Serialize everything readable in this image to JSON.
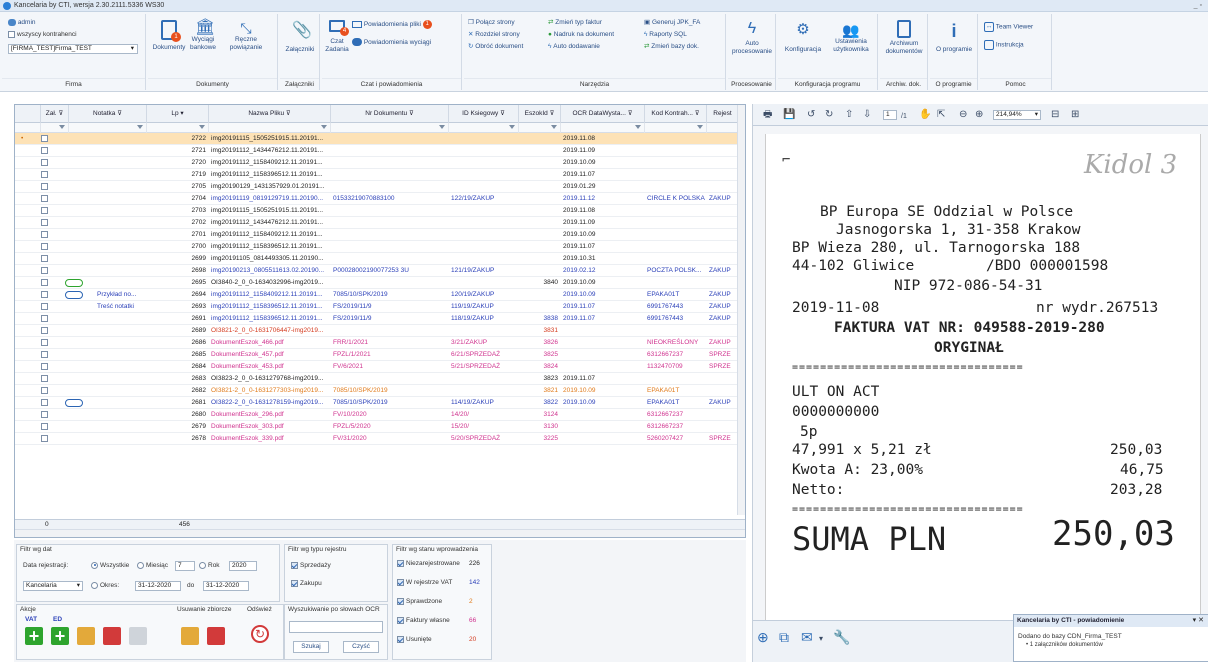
{
  "window": {
    "title": "Kancelaria by CTI, wersja 2.30.2111.5336 WS30",
    "controls": "_ ▫"
  },
  "ribbon": {
    "firma": {
      "user": "admin",
      "all_contractors": "wszyscy kontrahenci",
      "company": "[FIRMA_TEST]Firma_TEST",
      "label": "Firma"
    },
    "dokumenty": {
      "items": [
        "Dokumenty",
        "Wyciągi bankowe",
        "Ręczne powiązanie"
      ],
      "label": "Dokumenty",
      "badge": "1"
    },
    "zalaczniki": {
      "item": "Załączniki",
      "label": "Załączniki"
    },
    "czat": {
      "czat_zadania": "Czat Zadania",
      "badge": "4",
      "powiadomienia_pliki": "Powiadomienia pliki",
      "badge2": "1",
      "powiadomienia_wyciagi": "Powiadomienia wyciągi",
      "label": "Czat i powiadomienia"
    },
    "narzedzia": {
      "items": [
        "Połącz strony",
        "Zmień typ faktur",
        "Generuj JPK_FA",
        "Rozdziel strony",
        "Nadruk na dokument",
        "Raporty SQL",
        "Obróć dokument",
        "Auto dodawanie",
        "Zmień bazy dok."
      ],
      "label": "Narzędzia"
    },
    "procesowanie": {
      "item": "Auto procesowanie",
      "label": "Procesowanie"
    },
    "konfiguracja": {
      "items": [
        "Konfiguracja",
        "Ustawienia użytkownika"
      ],
      "label": "Konfiguracja programu"
    },
    "archiwum": {
      "item": "Archiwum dokumentów",
      "label": "Archiw. dok."
    },
    "oprogramie": {
      "item": "O programie",
      "label": "O programie"
    },
    "pomoc": {
      "items": [
        "Team Viewer",
        "Instrukcja"
      ],
      "label": "Pomoc"
    }
  },
  "grid": {
    "columns": [
      "Zał.",
      "Notatka",
      "Lp",
      "Nazwa Pliku",
      "Nr Dokumentu",
      "ID Ksiegowy",
      "EszokId",
      "OCR DataWysta...",
      "Kod Kontrah...",
      "Rejest"
    ],
    "rows": [
      {
        "lp": "2722",
        "file": "img20191115_1505251915.11.20191...",
        "nr": "",
        "id": "",
        "esz": "",
        "date": "2019.11.08",
        "kod": "",
        "rej": "",
        "color": "dark",
        "sel": true
      },
      {
        "lp": "2721",
        "file": "img20191112_1434476212.11.20191...",
        "nr": "",
        "id": "",
        "esz": "",
        "date": "2019.11.09",
        "kod": "",
        "rej": "",
        "color": "dark"
      },
      {
        "lp": "2720",
        "file": "img20191112_1158409212.11.20191...",
        "nr": "",
        "id": "",
        "esz": "",
        "date": "2019.10.09",
        "kod": "",
        "rej": "",
        "color": "dark"
      },
      {
        "lp": "2719",
        "file": "img20191112_1158396512.11.20191...",
        "nr": "",
        "id": "",
        "esz": "",
        "date": "2019.11.07",
        "kod": "",
        "rej": "",
        "color": "dark"
      },
      {
        "lp": "2705",
        "file": "img20190129_1431357929.01.20191...",
        "nr": "",
        "id": "",
        "esz": "",
        "date": "2019.01.29",
        "kod": "",
        "rej": "",
        "color": "dark"
      },
      {
        "lp": "2704",
        "file": "img20191119_0819129719.11.20190...",
        "nr": "01533219070883100",
        "id": "122/19/ZAKUP",
        "esz": "",
        "date": "2019.11.12",
        "kod": "CIRCLE K POLSKA",
        "rej": "ZAKUP",
        "color": "blue"
      },
      {
        "lp": "2703",
        "file": "img20191115_1505251915.11.20191...",
        "nr": "",
        "id": "",
        "esz": "",
        "date": "2019.11.08",
        "kod": "",
        "rej": "",
        "color": "dark"
      },
      {
        "lp": "2702",
        "file": "img20191112_1434476212.11.20191...",
        "nr": "",
        "id": "",
        "esz": "",
        "date": "2019.11.09",
        "kod": "",
        "rej": "",
        "color": "dark"
      },
      {
        "lp": "2701",
        "file": "img20191112_1158409212.11.20191...",
        "nr": "",
        "id": "",
        "esz": "",
        "date": "2019.10.09",
        "kod": "",
        "rej": "",
        "color": "dark"
      },
      {
        "lp": "2700",
        "file": "img20191112_1158396512.11.20191...",
        "nr": "",
        "id": "",
        "esz": "",
        "date": "2019.11.07",
        "kod": "",
        "rej": "",
        "color": "dark"
      },
      {
        "lp": "2699",
        "file": "img20191105_0814493305.11.20190...",
        "nr": "",
        "id": "",
        "esz": "",
        "date": "2019.10.31",
        "kod": "",
        "rej": "",
        "color": "dark"
      },
      {
        "lp": "2698",
        "file": "img20190213_0805511613.02.20190...",
        "nr": "P00028002190077253 3U",
        "id": "121/19/ZAKUP",
        "esz": "",
        "date": "2019.02.12",
        "kod": "POCZTA POLSK...",
        "rej": "ZAKUP",
        "color": "blue"
      },
      {
        "lp": "2695",
        "file": "OI3840-2_0_0-1634032996-img2019...",
        "nr": "",
        "id": "",
        "esz": "3840",
        "date": "2019.10.09",
        "kod": "",
        "rej": "",
        "color": "dark",
        "clip": "green"
      },
      {
        "lp": "2694",
        "file": "img20191112_1158409212.11.20191...",
        "nr": "7085/10/SPK/2019",
        "id": "120/19/ZAKUP",
        "esz": "",
        "date": "2019.10.09",
        "kod": "EPAKA01T",
        "rej": "ZAKUP",
        "color": "blue",
        "clip": "blue",
        "note": "Przykład no..."
      },
      {
        "lp": "2693",
        "file": "img20191112_1158396512.11.20191...",
        "nr": "FS/2019/11/9",
        "id": "119/19/ZAKUP",
        "esz": "",
        "date": "2019.11.07",
        "kod": "6991767443",
        "rej": "ZAKUP",
        "color": "blue",
        "note": "Treść notatki"
      },
      {
        "lp": "2691",
        "file": "img20191112_1158396512.11.20191...",
        "nr": "FS/2019/11/9",
        "id": "118/19/ZAKUP",
        "esz": "3838",
        "date": "2019.11.07",
        "kod": "6991767443",
        "rej": "ZAKUP",
        "color": "blue"
      },
      {
        "lp": "2689",
        "file": "OI3821-2_0_0-1631706447-img2019...",
        "nr": "",
        "id": "",
        "esz": "3831",
        "date": "",
        "kod": "",
        "rej": "",
        "color": "red"
      },
      {
        "lp": "2686",
        "file": "DokumentEszok_466.pdf",
        "nr": "FRR/1/2021",
        "id": "3/21/ZAKUP",
        "esz": "3826",
        "date": "",
        "kod": "NIEOKREŚLONY",
        "rej": "ZAKUP",
        "color": "pink"
      },
      {
        "lp": "2685",
        "file": "DokumentEszok_457.pdf",
        "nr": "FPZL/1/2021",
        "id": "6/21/SPRZEDAŻ",
        "esz": "3825",
        "date": "",
        "kod": "6312667237",
        "rej": "SPRZE",
        "color": "pink"
      },
      {
        "lp": "2684",
        "file": "DokumentEszok_453.pdf",
        "nr": "FV/6/2021",
        "id": "5/21/SPRZEDAŻ",
        "esz": "3824",
        "date": "",
        "kod": "1132470709",
        "rej": "SPRZE",
        "color": "pink"
      },
      {
        "lp": "2683",
        "file": "OI3823-2_0_0-1631279768-img2019...",
        "nr": "",
        "id": "",
        "esz": "3823",
        "date": "2019.11.07",
        "kod": "",
        "rej": "",
        "color": "dark"
      },
      {
        "lp": "2682",
        "file": "OI3821-2_0_0-1631277303-img2019...",
        "nr": "7085/10/SPK/2019",
        "id": "",
        "esz": "3821",
        "date": "2019.10.09",
        "kod": "EPAKA01T",
        "rej": "",
        "color": "orange"
      },
      {
        "lp": "2681",
        "file": "OI3822-2_0_0-1631278159-img2019...",
        "nr": "7085/10/SPK/2019",
        "id": "114/19/ZAKUP",
        "esz": "3822",
        "date": "2019.10.09",
        "kod": "EPAKA01T",
        "rej": "ZAKUP",
        "color": "blue",
        "clip": "blue"
      },
      {
        "lp": "2680",
        "file": "DokumentEszok_296.pdf",
        "nr": "FV/10/2020",
        "id": "14/20/",
        "esz": "3124",
        "date": "",
        "kod": "6312667237",
        "rej": "",
        "color": "pink"
      },
      {
        "lp": "2679",
        "file": "DokumentEszok_303.pdf",
        "nr": "FPZL/5/2020",
        "id": "15/20/",
        "esz": "3130",
        "date": "",
        "kod": "6312667237",
        "rej": "",
        "color": "pink"
      },
      {
        "lp": "2678",
        "file": "DokumentEszok_339.pdf",
        "nr": "FV/31/2020",
        "id": "5/20/SPRZEDAŻ",
        "esz": "3225",
        "date": "",
        "kod": "5260207427",
        "rej": "SPRZE",
        "color": "pink"
      }
    ],
    "footer_left": "0",
    "footer_count": "456"
  },
  "filters": {
    "date_title": "Filtr wg dat",
    "date_reg": "Data rejestracji:",
    "wszystkie": "Wszystkie",
    "miesiac": "Miesiąc",
    "month_val": "7",
    "rok": "Rok",
    "year_val": "2020",
    "kancelaria": "Kancelaria",
    "okres": "Okres:",
    "from": "31-12-2020",
    "do": "do",
    "to": "31-12-2020",
    "type_title": "Filtr wg typu rejestru",
    "sprzedazy": "Sprzedaży",
    "zakupu": "Zakupu",
    "state_title": "Filtr wg stanu wprowadzenia",
    "states": [
      {
        "l": "Niezarejestrowane",
        "v": "226",
        "c": "#222"
      },
      {
        "l": "W rejestrze VAT",
        "v": "142",
        "c": "#2a3fb8"
      },
      {
        "l": "Sprawdzone",
        "v": "2",
        "c": "#e07a1a"
      },
      {
        "l": "Faktury własne",
        "v": "66",
        "c": "#d0338f"
      },
      {
        "l": "Usunięte",
        "v": "20",
        "c": "#d43b1f"
      }
    ],
    "akcje": "Akcje",
    "vat": "VAT",
    "ed": "ED",
    "usuwanie": "Usuwanie zbiorcze",
    "odswiez": "Odśwież",
    "ocr_title": "Wyszukiwanie po słowach OCR",
    "szukaj": "Szukaj",
    "czysc": "Czyść"
  },
  "viewer": {
    "page": "1",
    "pages": "/1",
    "zoom": "214,94%"
  },
  "receipt": {
    "hand": "Kidol 3",
    "l1": "BP Europa SE Oddzial w Polsce",
    "l2": "Jasnogorska 1, 31-358 Krakow",
    "l3": "BP Wieza 280, ul. Tarnogorska 188",
    "l4a": "44-102 Gliwice",
    "l4b": "/BDO 000001598",
    "l5": "NIP 972-086-54-31",
    "l6a": "2019-11-08",
    "l6b": "nr wydr.267513",
    "l7": "FAKTURA VAT NR: 049588-2019-280",
    "l8": "ORYGINAŁ",
    "sep": "=================================",
    "l9": "ULT ON ACT",
    "l10": "0000000000",
    "l11": "5p",
    "l12a": "47,991 x 5,21  zł",
    "l12b": "250,03",
    "l13a": "Kwota A: 23,00%",
    "l13b": "46,75",
    "l14a": "Netto:",
    "l14b": "203,28",
    "suma": "SUMA PLN",
    "sumv": "250,03"
  },
  "notification": {
    "title": "Kancelaria by CTI - powiadomienie",
    "l1": "Dodano do bazy CDN_Firma_TEST",
    "l2": "• 1 załączników dokumentów"
  }
}
